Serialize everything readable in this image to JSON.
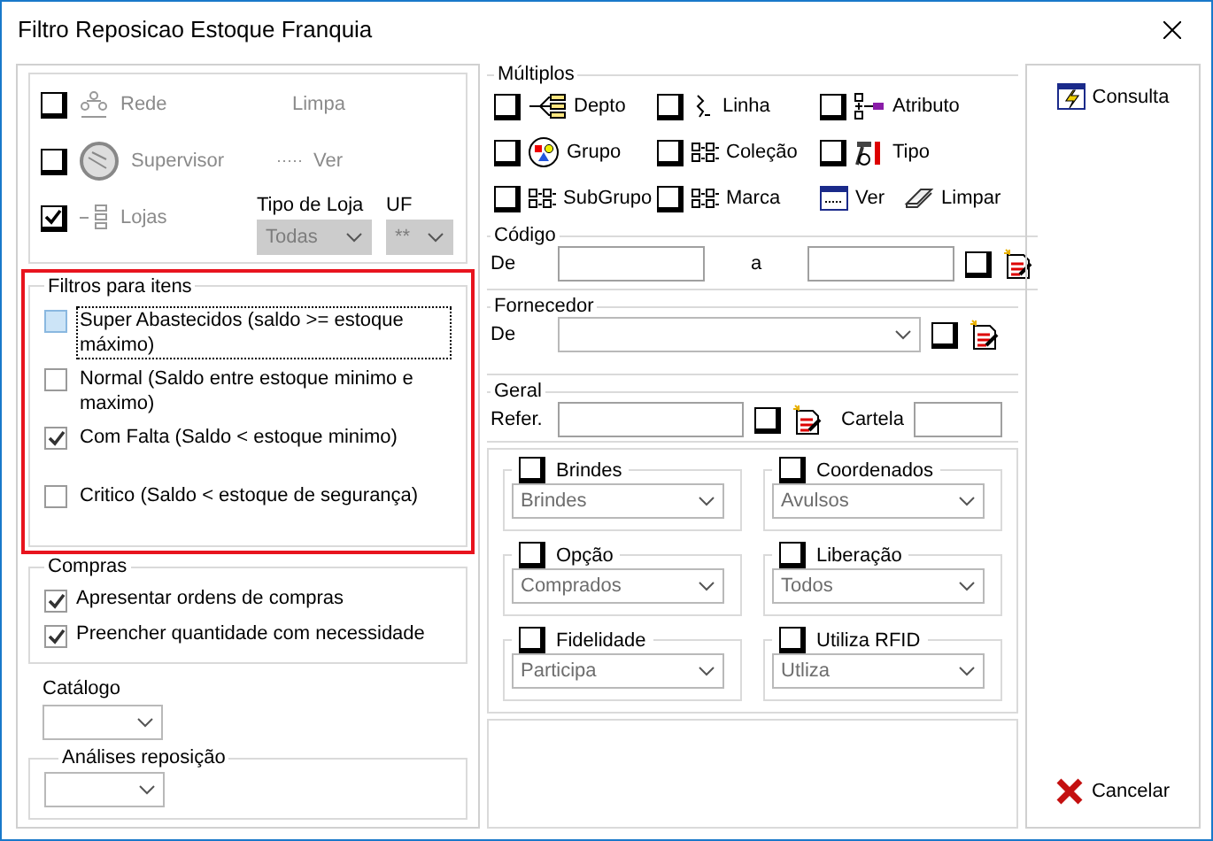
{
  "window": {
    "title": "Filtro Reposicao Estoque Franquia"
  },
  "selectors": [
    {
      "label": "Rede",
      "checked": false,
      "disabled": true
    },
    {
      "label": "Supervisor",
      "checked": false,
      "disabled": true
    },
    {
      "label": "Lojas",
      "checked": true,
      "disabled": true
    }
  ],
  "links": [
    "Limpa",
    "Ver"
  ],
  "tipo_loja": {
    "label": "Tipo de Loja",
    "value": "Todas"
  },
  "uf": {
    "label": "UF",
    "value": "**"
  },
  "filtros": {
    "title": "Filtros para itens",
    "items": [
      {
        "label": "Super Abastecidos  (saldo >= estoque máximo)",
        "checked": false,
        "focused": true
      },
      {
        "label": "Normal (Saldo entre estoque minimo e maximo)",
        "checked": false,
        "focused": false
      },
      {
        "label": "Com Falta (Saldo < estoque minimo)",
        "checked": true,
        "focused": false
      },
      {
        "label": "Critico (Saldo < estoque de segurança)",
        "checked": false,
        "focused": false
      }
    ]
  },
  "compras": {
    "title": "Compras",
    "items": [
      {
        "label": "Apresentar ordens de compras",
        "checked": true
      },
      {
        "label": "Preencher quantidade com necessidade",
        "checked": true
      }
    ]
  },
  "catalogo": {
    "label": "Catálogo"
  },
  "analises": {
    "label": "Análises reposição"
  },
  "multiplos": {
    "title": "Múltiplos",
    "items": [
      {
        "label": "Depto",
        "checked": false
      },
      {
        "label": "Linha",
        "checked": false
      },
      {
        "label": "Atributo",
        "checked": false
      },
      {
        "label": "Grupo",
        "checked": false
      },
      {
        "label": "Coleção",
        "checked": false
      },
      {
        "label": "Tipo",
        "checked": false
      },
      {
        "label": "SubGrupo",
        "checked": false
      },
      {
        "label": "Marca",
        "checked": false
      }
    ],
    "actions": [
      "Ver",
      "Limpar"
    ]
  },
  "codigo": {
    "title": "Código",
    "from_label": "De",
    "to_label": "a",
    "checked": false
  },
  "fornecedor": {
    "title": "Fornecedor",
    "label": "De",
    "checked": false
  },
  "geral": {
    "title": "Geral",
    "refer_label": "Refer.",
    "checked": false,
    "cartela_label": "Cartela"
  },
  "options": [
    {
      "label": "Brindes",
      "checked": false,
      "value": "Brindes"
    },
    {
      "label": "Coordenados",
      "checked": false,
      "value": "Avulsos"
    },
    {
      "label": "Opção",
      "checked": false,
      "value": "Comprados"
    },
    {
      "label": "Liberação",
      "checked": false,
      "value": "Todos"
    },
    {
      "label": "Fidelidade",
      "checked": false,
      "value": "Participa"
    },
    {
      "label": "Utiliza RFID",
      "checked": false,
      "value": "Utliza"
    }
  ],
  "buttons": [
    {
      "label": "Consulta",
      "kind": "consult"
    },
    {
      "label": "Cancelar",
      "kind": "cancel"
    }
  ]
}
